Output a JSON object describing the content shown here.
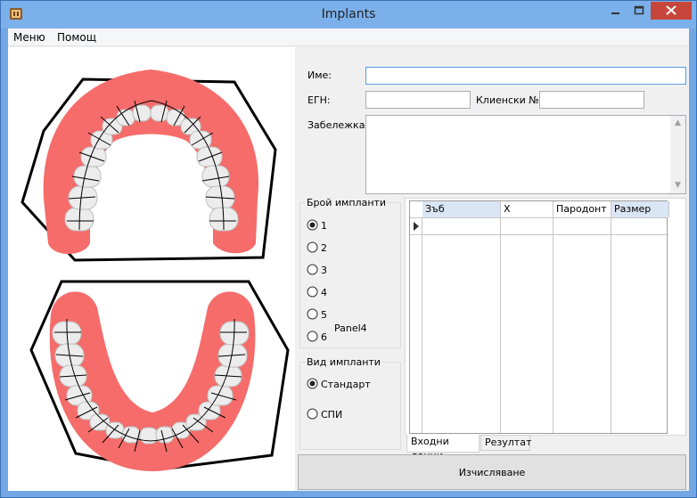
{
  "window": {
    "title": "Implants"
  },
  "menu": {
    "items": [
      {
        "label": "Меню"
      },
      {
        "label": "Помощ"
      }
    ]
  },
  "form": {
    "name_label": "Име:",
    "name_value": "",
    "egn_label": "ЕГН:",
    "egn_value": "",
    "clinic_label": "Клиенски №",
    "clinic_value": "",
    "note_label": "Забележка:",
    "note_value": ""
  },
  "implant_count": {
    "title": "Брой импланти",
    "options": [
      "1",
      "2",
      "3",
      "4",
      "5",
      "6"
    ],
    "selected": "1",
    "panel_label": "Panel4"
  },
  "implant_type": {
    "title": "Вид импланти",
    "options": [
      "Стандарт",
      "СПИ"
    ],
    "selected": "Стандарт"
  },
  "grid": {
    "columns": [
      "Зъб",
      "X",
      "Пародонт",
      "Размер"
    ],
    "rows": []
  },
  "tabs": [
    {
      "label": "Входни данни",
      "active": true
    },
    {
      "label": "Резултат",
      "active": false
    }
  ],
  "calc_button": {
    "label": "Изчисляване"
  },
  "colors": {
    "gum": "#f56c6a",
    "window_frame": "#73a6e4",
    "close_button": "#c7463b"
  }
}
